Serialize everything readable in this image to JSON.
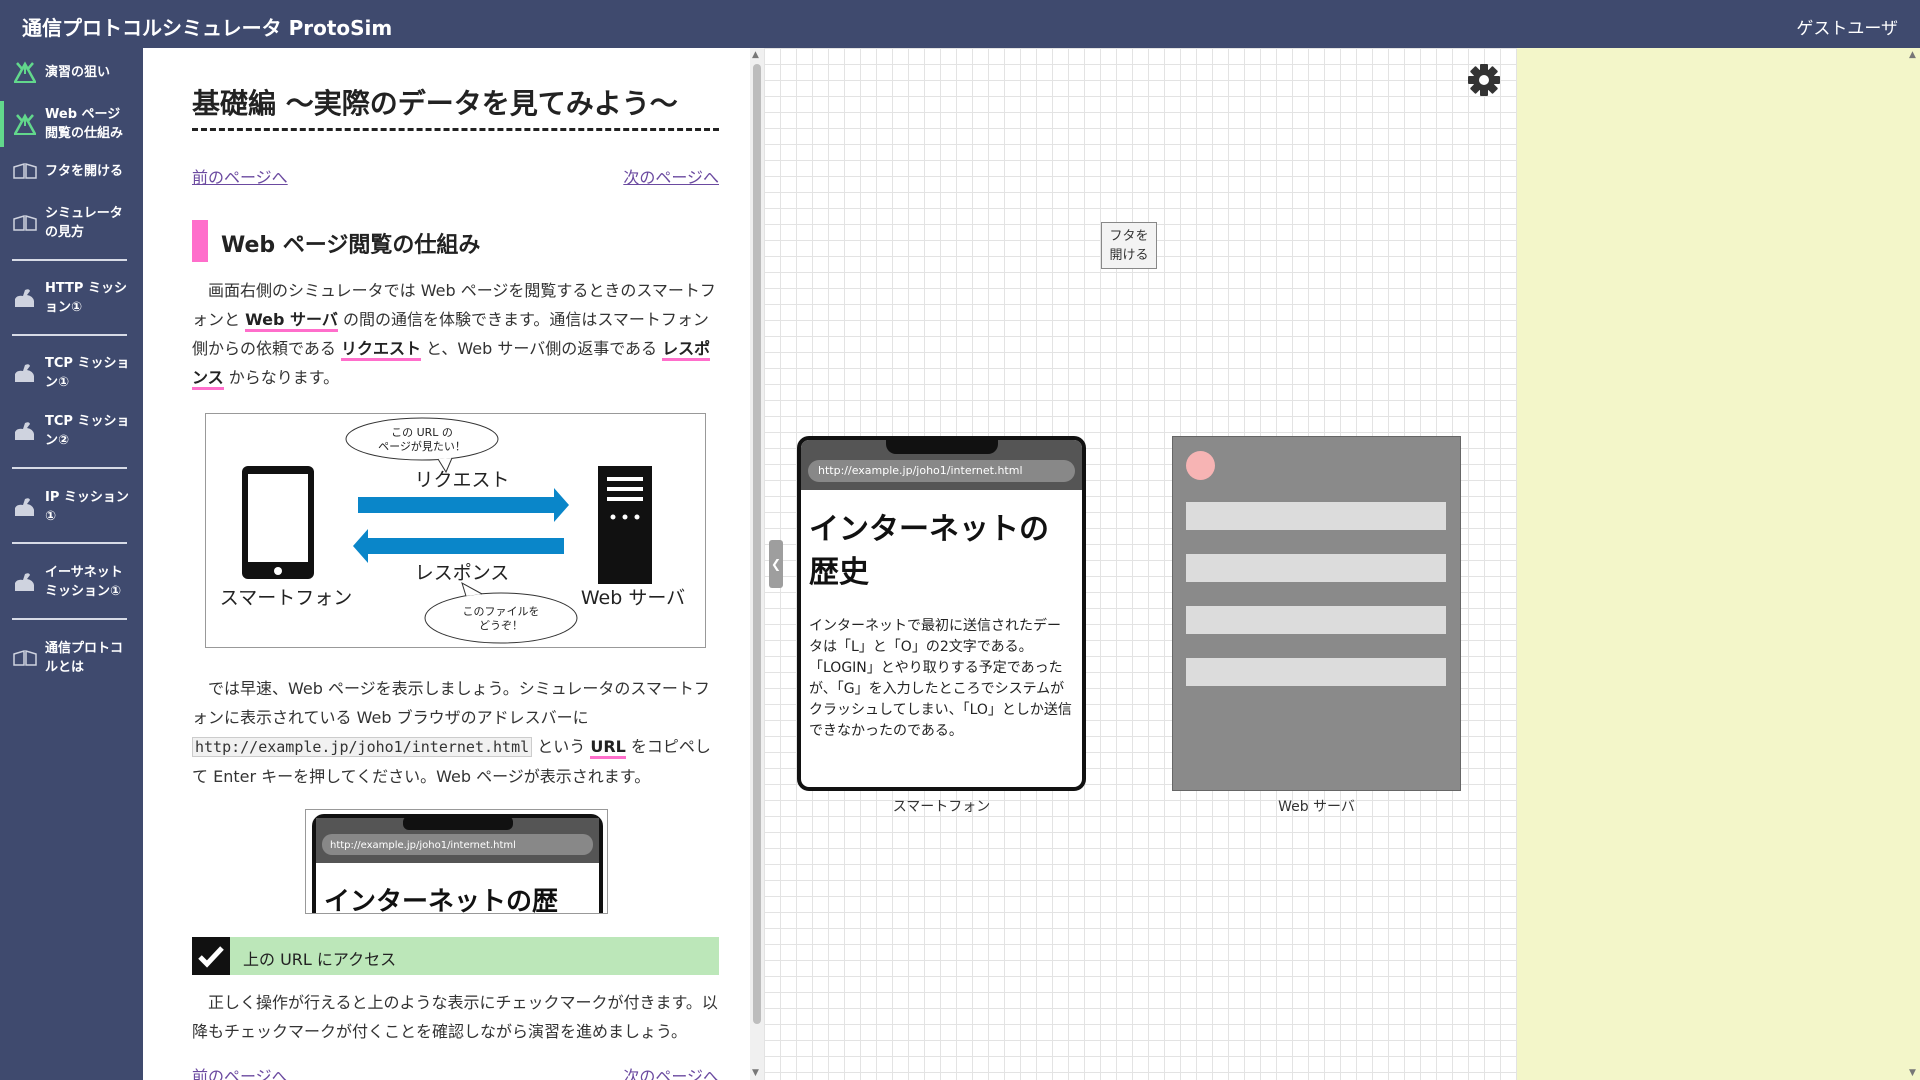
{
  "app": {
    "title": "通信プロトコルシミュレータ ProtoSim",
    "user": "ゲストユーザ"
  },
  "sidebar": {
    "items": [
      {
        "label": "演習の狙い",
        "icon": "target-flag-icon"
      },
      {
        "label": "Web ページ閲覧の仕組み",
        "icon": "target-flag-icon"
      },
      {
        "label": "フタを開ける",
        "icon": "open-book-icon"
      },
      {
        "label": "シミュレータの見方",
        "icon": "open-book-icon"
      },
      {
        "label": "HTTP ミッション①",
        "icon": "flexed-arm-icon"
      },
      {
        "label": "TCP ミッション①",
        "icon": "flexed-arm-icon"
      },
      {
        "label": "TCP ミッション②",
        "icon": "flexed-arm-icon"
      },
      {
        "label": "IP ミッション①",
        "icon": "flexed-arm-icon"
      },
      {
        "label": "イーサネットミッション①",
        "icon": "flexed-arm-icon"
      },
      {
        "label": "通信プロトコルとは",
        "icon": "open-book-icon"
      }
    ]
  },
  "article": {
    "title": "基礎編 〜実際のデータを見てみよう〜",
    "prev_link": "前のページへ",
    "next_link": "次のページへ",
    "section_title": "Web ページ閲覧の仕組み",
    "para1": {
      "t1": "画面右側のシミュレータでは Web ページを閲覧するときのスマートフォンと ",
      "k1": "Web サーバ",
      "t2": " の間の通信を体験できます。通信はスマートフォン側からの依頼である ",
      "k2": "リクエスト",
      "t3": " と、Web サーバ側の返事である ",
      "k3": "レスポンス",
      "t4": " からなります。"
    },
    "diagram": {
      "bubble_top": [
        "この URL の",
        "ページが見たい！"
      ],
      "request_label": "リクエスト",
      "response_label": "レスポンス",
      "bubble_bottom": [
        "このファイルを",
        "どうぞ！"
      ],
      "phone_label": "スマートフォン",
      "server_label": "Web サーバ"
    },
    "para2": {
      "t1": "では早速、Web ページを表示しましょう。シミュレータのスマートフォンに表示されている Web ブラウザのアドレスバーに ",
      "code": "http://example.jp/joho1/internet.html",
      "t2": " という ",
      "k1": "URL",
      "t3": " をコピペして Enter キーを押してください。Web ページが表示されます。"
    },
    "mini_preview": {
      "url": "http://example.jp/joho1/internet.html",
      "heading": "インターネットの歴"
    },
    "task_label": "上の URL にアクセス",
    "para3": "正しく操作が行えると上のような表示にチェックマークが付きます。以降もチェックマークが付くことを確認しながら演習を進めましょう。",
    "prev_link_bottom": "前のページへ",
    "next_link_bottom": "次のページへ"
  },
  "simulator": {
    "open_lid_button": [
      "フタを",
      "開ける"
    ],
    "phone": {
      "url": "http://example.jp/joho1/internet.html",
      "heading": "インターネットの歴史",
      "body": "インターネットで最初に送信されたデータは「L」と「O」の2文字である。「LOGIN」とやり取りする予定であったが、「G」を入力したところでシステムがクラッシュしてしまい、「LO」としか送信できなかったのである。",
      "caption": "スマートフォン"
    },
    "server": {
      "caption": "Web サーバ"
    }
  },
  "colors": {
    "topbar": "#3f4a6e",
    "accent_pink": "#ff6ecb",
    "task_green": "#bce7b9",
    "right_panel": "#f3f6c9",
    "arrow_blue": "#0a86c9"
  }
}
